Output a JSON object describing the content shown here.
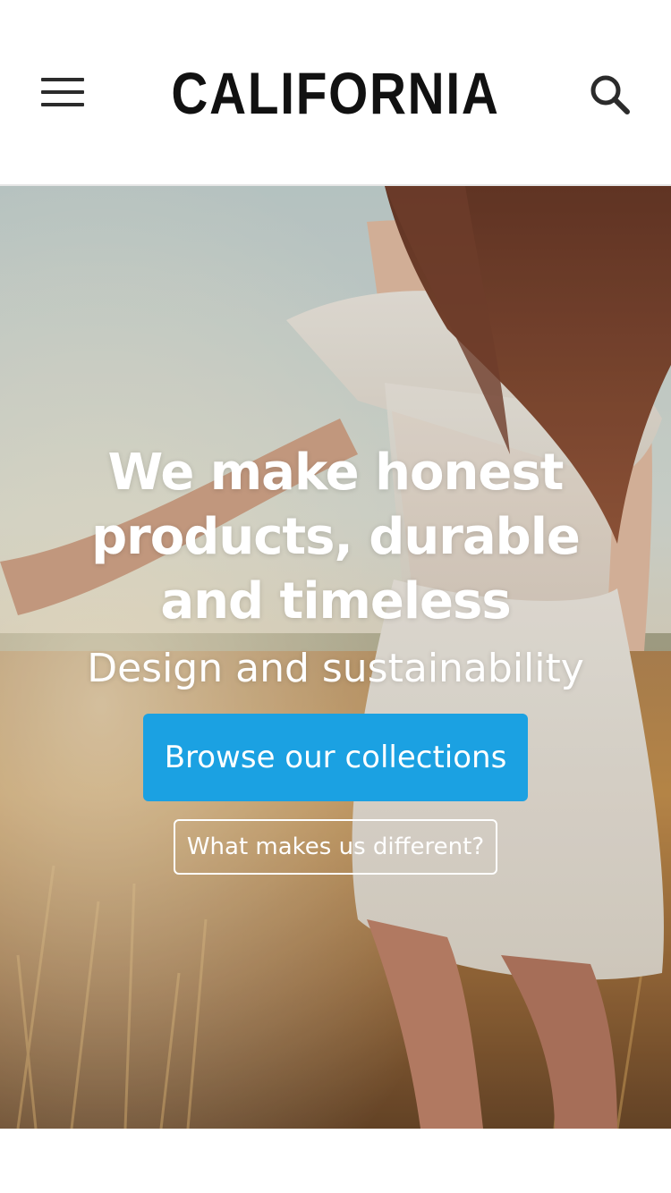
{
  "header": {
    "logo_text": "CALIFORNIA",
    "menu_icon": "hamburger-menu-icon",
    "search_icon": "search-icon"
  },
  "hero": {
    "title": "We make honest products, durable and timeless",
    "subtitle": "Design and sustainability",
    "primary_cta_label": "Browse our collections",
    "secondary_cta_label": "What makes us different?"
  },
  "colors": {
    "accent": "#1ba1e2",
    "header_text": "#111111",
    "hero_text": "#ffffff"
  }
}
